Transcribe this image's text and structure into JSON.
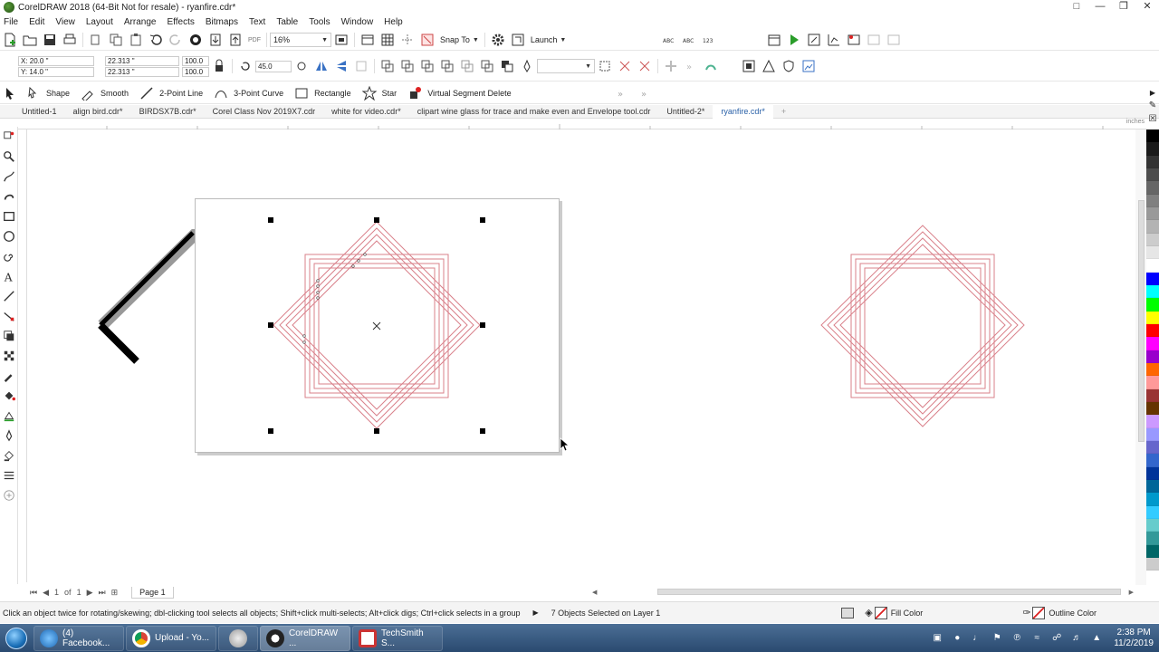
{
  "window": {
    "title": "CorelDRAW 2018 (64-Bit Not for resale) - ryanfire.cdr*"
  },
  "menu": [
    "File",
    "Edit",
    "View",
    "Layout",
    "Arrange",
    "Effects",
    "Bitmaps",
    "Text",
    "Table",
    "Tools",
    "Window",
    "Help"
  ],
  "toolbar": {
    "zoom": "16%",
    "snap_label": "Snap To",
    "launch_label": "Launch",
    "pdf_label": "PDF"
  },
  "property_bar": {
    "x": "X: 20.0 \"",
    "y": "Y: 14.0 \"",
    "width": "22.313 \"",
    "height": "22.313 \"",
    "scale_w": "100.0",
    "scale_h": "100.0",
    "angle": "45.0"
  },
  "tools_bar": {
    "shape": "Shape",
    "smooth": "Smooth",
    "two_point_line": "2-Point Line",
    "three_point_curve": "3-Point Curve",
    "rectangle": "Rectangle",
    "star": "Star",
    "virtual_segment_delete": "Virtual Segment Delete"
  },
  "doc_tabs": [
    "Untitled-1",
    "align bird.cdr*",
    "BIRDSX7B.cdr*",
    "Corel Class Nov 2019X7.cdr",
    "white for video.cdr*",
    "clipart wine glass for trace and make even and Envelope tool.cdr",
    "Untitled-2*",
    "ryanfire.cdr*"
  ],
  "ruler_unit": "inches",
  "page_nav": {
    "current": "1",
    "of": "of",
    "total": "1",
    "page_tab": "Page 1"
  },
  "status": {
    "hint": "Click an object twice for rotating/skewing; dbl-clicking tool selects all objects; Shift+click multi-selects; Alt+click digs; Ctrl+click selects in a group",
    "selection": "7 Objects Selected on Layer 1",
    "fill": "Fill Color",
    "outline": "Outline Color"
  },
  "taskbar": {
    "items": [
      "(4) Facebook...",
      "Upload - Yo...",
      "",
      "CorelDRAW ...",
      "TechSmith S..."
    ],
    "time": "2:38 PM",
    "date": "11/2/2019"
  },
  "colors": {
    "accent": "#2a61a8",
    "shape_stroke": "#d9808a",
    "palette": [
      "#000000",
      "#1a1a1a",
      "#333333",
      "#4d4d4d",
      "#666666",
      "#808080",
      "#999999",
      "#b3b3b3",
      "#cccccc",
      "#e6e6e6",
      "#ffffff",
      "#0000ff",
      "#00ffff",
      "#00ff00",
      "#ffff00",
      "#ff0000",
      "#ff00ff",
      "#9900cc",
      "#ff6600",
      "#ff9999",
      "#993333",
      "#663300",
      "#cc99ff",
      "#9999ff",
      "#6666cc",
      "#3366cc",
      "#003399",
      "#006699",
      "#0099cc",
      "#33ccff",
      "#66cccc",
      "#339999",
      "#006666",
      "#cccccc"
    ]
  }
}
